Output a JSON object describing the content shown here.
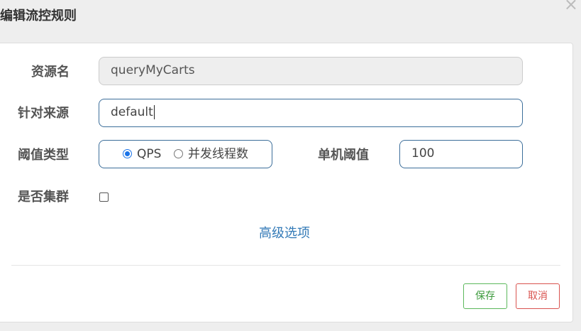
{
  "dialog": {
    "title": "编辑流控规则",
    "close_glyph": "×"
  },
  "form": {
    "resource_name_label": "资源名",
    "resource_name_value": "queryMyCarts",
    "limit_app_label": "针对来源",
    "limit_app_value": "default",
    "threshold_type_label": "阈值类型",
    "threshold_type_options": [
      "QPS",
      "并发线程数"
    ],
    "threshold_type_selected": "QPS",
    "single_threshold_label": "单机阈值",
    "single_threshold_value": "100",
    "cluster_label": "是否集群",
    "cluster_checked": false,
    "advanced_link": "高级选项"
  },
  "footer": {
    "save_label": "保存",
    "cancel_label": "取消"
  },
  "colors": {
    "input_border": "#3c6e9a",
    "link": "#337ab7",
    "save": "#5cb85c",
    "cancel": "#d9534f",
    "radio_checked": "#1a73e8"
  },
  "icons": {
    "close": "close-icon"
  }
}
